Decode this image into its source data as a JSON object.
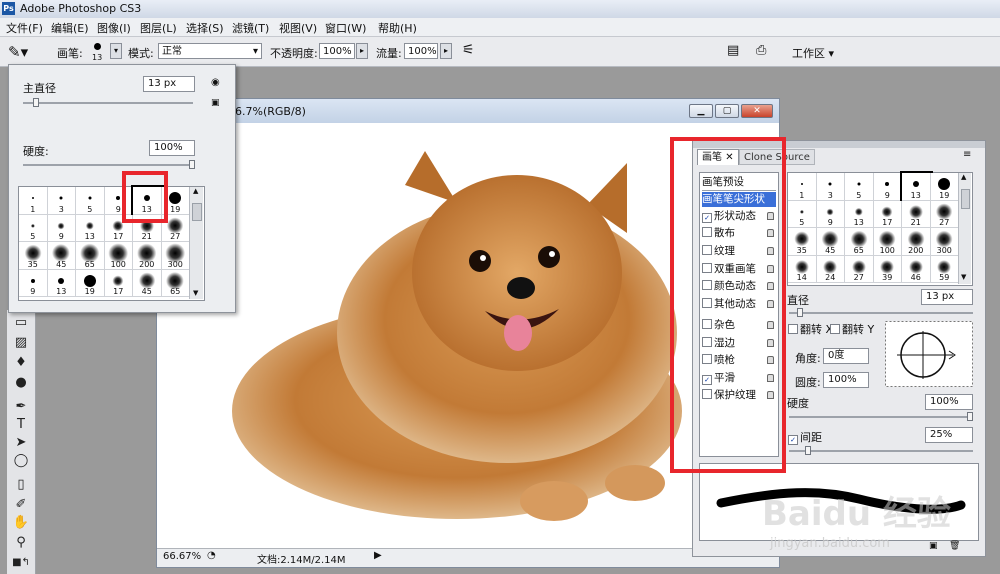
{
  "app": {
    "icon_text": "Ps",
    "title": "Adobe Photoshop CS3"
  },
  "menu": [
    "文件(F)",
    "编辑(E)",
    "图像(I)",
    "图层(L)",
    "选择(S)",
    "滤镜(T)",
    "视图(V)",
    "窗口(W)",
    "帮助(H)"
  ],
  "options_bar": {
    "brush_label": "画笔:",
    "brush_size": "13",
    "mode_label": "模式:",
    "mode_value": "正常",
    "opacity_label": "不透明度:",
    "opacity_value": "100%",
    "flow_label": "流量:",
    "flow_value": "100%",
    "workspace_label": "工作区"
  },
  "brush_picker": {
    "diameter_label": "主直径",
    "diameter_value": "13 px",
    "hardness_label": "硬度:",
    "hardness_value": "100%",
    "presets": [
      {
        "n": "1",
        "d": 2,
        "soft": false
      },
      {
        "n": "3",
        "d": 3,
        "soft": false
      },
      {
        "n": "5",
        "d": 3,
        "soft": false
      },
      {
        "n": "9",
        "d": 4,
        "soft": false
      },
      {
        "n": "13",
        "d": 6,
        "soft": false
      },
      {
        "n": "19",
        "d": 12,
        "soft": false
      },
      {
        "n": "5",
        "d": 3,
        "soft": true
      },
      {
        "n": "9",
        "d": 5,
        "soft": true
      },
      {
        "n": "13",
        "d": 6,
        "soft": true
      },
      {
        "n": "17",
        "d": 8,
        "soft": true
      },
      {
        "n": "21",
        "d": 10,
        "soft": true
      },
      {
        "n": "27",
        "d": 12,
        "soft": true
      },
      {
        "n": "35",
        "d": 12,
        "soft": true
      },
      {
        "n": "45",
        "d": 13,
        "soft": true
      },
      {
        "n": "65",
        "d": 14,
        "soft": true
      },
      {
        "n": "100",
        "d": 14,
        "soft": true
      },
      {
        "n": "200",
        "d": 14,
        "soft": true
      },
      {
        "n": "300",
        "d": 14,
        "soft": true
      },
      {
        "n": "9",
        "d": 4,
        "soft": false
      },
      {
        "n": "13",
        "d": 6,
        "soft": false
      },
      {
        "n": "19",
        "d": 12,
        "soft": false
      },
      {
        "n": "17",
        "d": 8,
        "soft": true
      },
      {
        "n": "45",
        "d": 12,
        "soft": true
      },
      {
        "n": "65",
        "d": 13,
        "soft": true
      }
    ]
  },
  "document": {
    "title": "6.7%(RGB/8)",
    "zoom": "66.67%",
    "doc_info": "文档:2.14M/2.14M"
  },
  "brushes_panel": {
    "tabs": [
      "画笔",
      "Clone Source"
    ],
    "list_header": "画笔预设",
    "list": [
      {
        "label": "画笔笔尖形状",
        "type": "selected"
      },
      {
        "label": "形状动态",
        "type": "check",
        "checked": true
      },
      {
        "label": "散布",
        "type": "check",
        "checked": false
      },
      {
        "label": "纹理",
        "type": "check",
        "checked": false
      },
      {
        "label": "双重画笔",
        "type": "check",
        "checked": false
      },
      {
        "label": "颜色动态",
        "type": "check",
        "checked": false
      },
      {
        "label": "其他动态",
        "type": "check",
        "checked": false
      },
      {
        "label": "杂色",
        "type": "check",
        "checked": false
      },
      {
        "label": "湿边",
        "type": "check",
        "checked": false
      },
      {
        "label": "喷枪",
        "type": "check",
        "checked": false
      },
      {
        "label": "平滑",
        "type": "check",
        "checked": true
      },
      {
        "label": "保护纹理",
        "type": "check",
        "checked": false
      }
    ],
    "tips": [
      {
        "n": "1",
        "d": 2,
        "soft": false
      },
      {
        "n": "3",
        "d": 3,
        "soft": false
      },
      {
        "n": "5",
        "d": 3,
        "soft": false
      },
      {
        "n": "9",
        "d": 4,
        "soft": false
      },
      {
        "n": "13",
        "d": 6,
        "soft": false
      },
      {
        "n": "19",
        "d": 12,
        "soft": false
      },
      {
        "n": "5",
        "d": 3,
        "soft": true
      },
      {
        "n": "9",
        "d": 5,
        "soft": true
      },
      {
        "n": "13",
        "d": 6,
        "soft": true
      },
      {
        "n": "17",
        "d": 8,
        "soft": true
      },
      {
        "n": "21",
        "d": 10,
        "soft": true
      },
      {
        "n": "27",
        "d": 12,
        "soft": true
      },
      {
        "n": "35",
        "d": 11,
        "soft": true
      },
      {
        "n": "45",
        "d": 12,
        "soft": true
      },
      {
        "n": "65",
        "d": 12,
        "soft": true
      },
      {
        "n": "100",
        "d": 12,
        "soft": true
      },
      {
        "n": "200",
        "d": 12,
        "soft": true
      },
      {
        "n": "300",
        "d": 12,
        "soft": true
      },
      {
        "n": "14",
        "d": 10,
        "soft": true
      },
      {
        "n": "24",
        "d": 10,
        "soft": true
      },
      {
        "n": "27",
        "d": 10,
        "soft": true
      },
      {
        "n": "39",
        "d": 10,
        "soft": true
      },
      {
        "n": "46",
        "d": 10,
        "soft": true
      },
      {
        "n": "59",
        "d": 10,
        "soft": true
      }
    ],
    "diameter_label": "直径",
    "diameter_value": "13 px",
    "flip_x": "翻转 X",
    "flip_y": "翻转 Y",
    "angle_label": "角度:",
    "angle_value": "0度",
    "roundness_label": "圆度:",
    "roundness_value": "100%",
    "hardness_label": "硬度",
    "hardness_value": "100%",
    "spacing_label": "间距",
    "spacing_value": "25%"
  },
  "watermark": {
    "brand": "Baidu 经验",
    "url": "jingyan.baidu.com"
  }
}
